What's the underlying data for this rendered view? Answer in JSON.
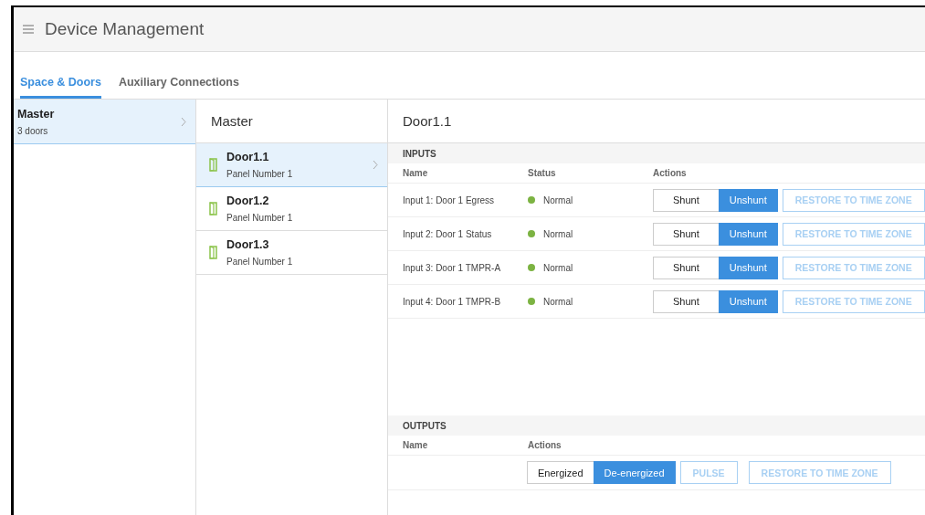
{
  "header": {
    "title": "Device Management"
  },
  "tabs": [
    {
      "label": "Space & Doors",
      "selected": true
    },
    {
      "label": "Auxiliary Connections",
      "selected": false
    }
  ],
  "spaces": [
    {
      "name": "Master",
      "subtitle": "3 doors",
      "selected": true
    }
  ],
  "doors_panel": {
    "title": "Master",
    "doors": [
      {
        "name": "Door1.1",
        "subtitle": "Panel Number 1",
        "selected": true
      },
      {
        "name": "Door1.2",
        "subtitle": "Panel Number 1",
        "selected": false
      },
      {
        "name": "Door1.3",
        "subtitle": "Panel Number 1",
        "selected": false
      }
    ]
  },
  "detail": {
    "title": "Door1.1",
    "inputs": {
      "heading": "INPUTS",
      "columns": [
        "Name",
        "Status",
        "Actions"
      ],
      "rows": [
        {
          "name": "Input 1: Door 1 Egress",
          "status": "Normal",
          "color": "#7cb342",
          "toggle": [
            {
              "label": "Shunt",
              "selected": false
            },
            {
              "label": "Unshunt",
              "selected": true
            }
          ],
          "restore": "RESTORE TO TIME ZONE"
        },
        {
          "name": "Input 2: Door 1 Status",
          "status": "Normal",
          "color": "#7cb342",
          "toggle": [
            {
              "label": "Shunt",
              "selected": false
            },
            {
              "label": "Unshunt",
              "selected": true
            }
          ],
          "restore": "RESTORE TO TIME ZONE"
        },
        {
          "name": "Input 3: Door 1 TMPR-A",
          "status": "Normal",
          "color": "#7cb342",
          "toggle": [
            {
              "label": "Shunt",
              "selected": false
            },
            {
              "label": "Unshunt",
              "selected": true
            }
          ],
          "restore": "RESTORE TO TIME ZONE"
        },
        {
          "name": "Input 4: Door 1 TMPR-B",
          "status": "Normal",
          "color": "#7cb342",
          "toggle": [
            {
              "label": "Shunt",
              "selected": false
            },
            {
              "label": "Unshunt",
              "selected": true
            }
          ],
          "restore": "RESTORE TO TIME ZONE"
        }
      ]
    },
    "outputs": {
      "heading": "OUTPUTS",
      "columns": [
        "Name",
        "Actions"
      ],
      "rows": [
        {
          "toggle": [
            {
              "label": "Energized",
              "selected": false
            },
            {
              "label": "De-energized",
              "selected": true
            }
          ],
          "pulse": "PULSE",
          "restore": "RESTORE TO TIME ZONE"
        }
      ]
    }
  }
}
